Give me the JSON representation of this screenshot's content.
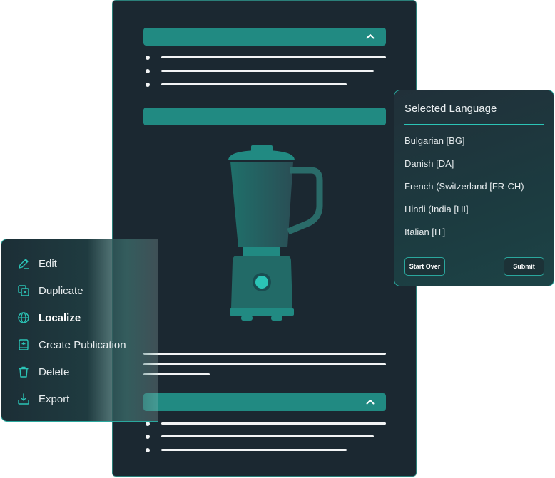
{
  "document": {
    "top_section_chevron": "chevron-up",
    "bottom_section_chevron": "chevron-up",
    "product_image": "blender"
  },
  "language_panel": {
    "title": "Selected Language",
    "languages": [
      "Bulgarian [BG]",
      "Danish [DA]",
      "French (Switzerland [FR-CH)",
      "Hindi (India [HI]",
      "Italian [IT]"
    ],
    "start_over_label": "Start Over",
    "submit_label": "Submit"
  },
  "context_menu": {
    "items": [
      {
        "label": "Edit",
        "icon": "pencil-icon"
      },
      {
        "label": "Duplicate",
        "icon": "duplicate-icon"
      },
      {
        "label": "Localize",
        "icon": "globe-icon",
        "active": true
      },
      {
        "label": "Create Publication",
        "icon": "book-plus-icon"
      },
      {
        "label": "Delete",
        "icon": "trash-icon"
      },
      {
        "label": "Export",
        "icon": "export-icon"
      }
    ]
  },
  "colors": {
    "accent": "#218a82",
    "border": "#2aa79d",
    "dark_bg": "#1b2831"
  }
}
